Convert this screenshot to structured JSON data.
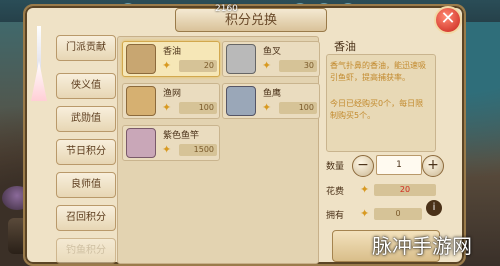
{
  "dialog": {
    "title": "积分兑换",
    "top_number": "2160",
    "close_label": "✕"
  },
  "tabs": [
    {
      "label": "门派贡献"
    },
    {
      "label": "侠义值"
    },
    {
      "label": "武勋值"
    },
    {
      "label": "节日积分"
    },
    {
      "label": "良师值"
    },
    {
      "label": "召回积分"
    },
    {
      "label": "钓鱼积分"
    }
  ],
  "items": [
    {
      "name": "香油",
      "price": "20",
      "icon": "oil-bottle-icon",
      "selected": true
    },
    {
      "name": "鱼叉",
      "price": "30",
      "icon": "fish-spear-icon"
    },
    {
      "name": "渔网",
      "price": "100",
      "icon": "fishing-net-icon"
    },
    {
      "name": "鱼鹰",
      "price": "100",
      "icon": "cormorant-icon"
    },
    {
      "name": "紫色鱼竿",
      "price": "1500",
      "icon": "purple-fishing-rod-icon"
    }
  ],
  "detail": {
    "name": "香油",
    "description": "香气扑鼻的香油，能迅速吸引鱼虾，提高捕获率。",
    "limit_text": "今日已经购买0个，每日限制购买5个。",
    "qty_label": "数量",
    "qty_value": "1",
    "cost_label": "花费",
    "cost_value": "20",
    "own_label": "拥有",
    "own_value": "0",
    "info_icon": "i"
  },
  "watermark": "脉冲手游网",
  "colors": {
    "accent": "#d89a22",
    "panel": "#efe2c6",
    "close": "#c8231b"
  }
}
